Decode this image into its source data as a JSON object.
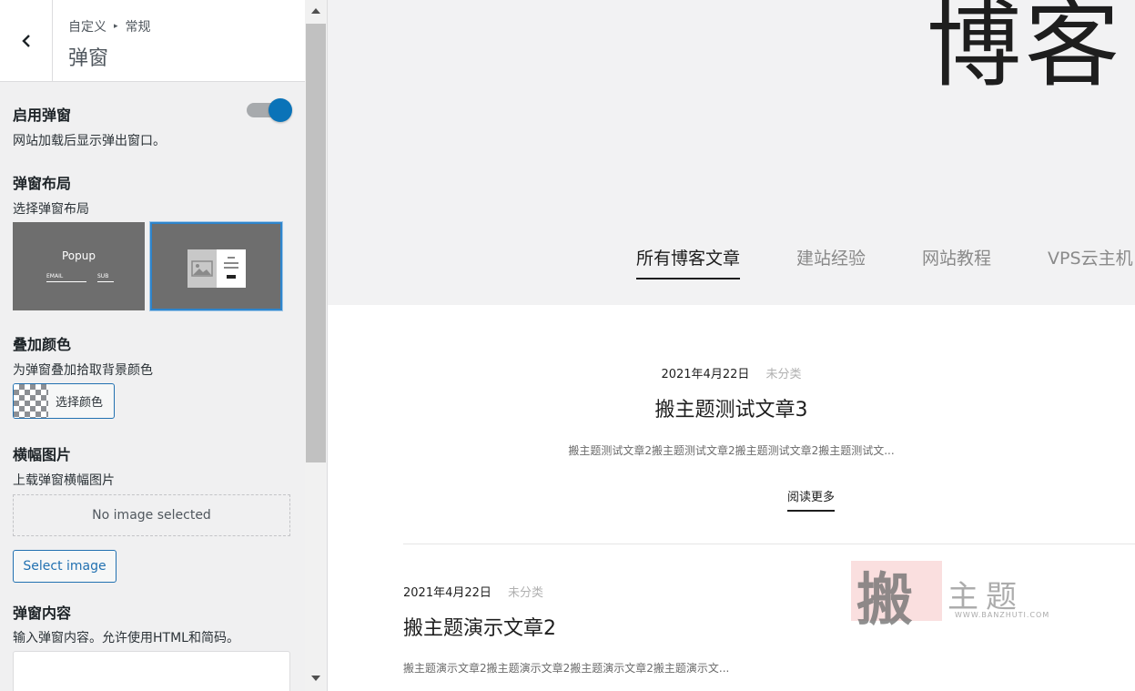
{
  "sidebar": {
    "breadcrumb": {
      "root": "自定义",
      "parent": "常规"
    },
    "title": "弹窗",
    "enable": {
      "title": "启用弹窗",
      "desc": "网站加载后显示弹出窗口。"
    },
    "layout": {
      "title": "弹窗布局",
      "desc": "选择弹窗布局",
      "opt1_title": "Popup",
      "opt1_email": "EMAIL",
      "opt1_sub": "SUB"
    },
    "overlay": {
      "title": "叠加颜色",
      "desc": "为弹窗叠加拾取背景颜色",
      "button": "选择颜色"
    },
    "banner": {
      "title": "横幅图片",
      "desc": "上载弹窗横幅图片",
      "empty": "No image selected",
      "button": "Select image"
    },
    "content": {
      "title": "弹窗内容",
      "desc": "输入弹窗内容。允许使用HTML和简码。"
    }
  },
  "preview": {
    "hero_title": "博客",
    "tabs": [
      "所有博客文章",
      "建站经验",
      "网站教程",
      "VPS云主机"
    ],
    "posts": [
      {
        "date": "2021年4月22日",
        "category": "未分类",
        "title": "搬主题测试文章3",
        "excerpt": "搬主题测试文章2搬主题测试文章2搬主题测试文章2搬主题测试文...",
        "readmore": "阅读更多"
      },
      {
        "date": "2021年4月22日",
        "category": "未分类",
        "title": "搬主题演示文章2",
        "excerpt": "搬主题演示文章2搬主题演示文章2搬主题演示文章2搬主题演示文..."
      }
    ],
    "watermark": {
      "big": "搬",
      "small": "主题",
      "url": "WWW.BANZHUTI.COM"
    }
  },
  "colors": {
    "accent": "#2271b1",
    "toggle_on": "#0a73b8",
    "layout_bg": "#6e6e6e"
  }
}
